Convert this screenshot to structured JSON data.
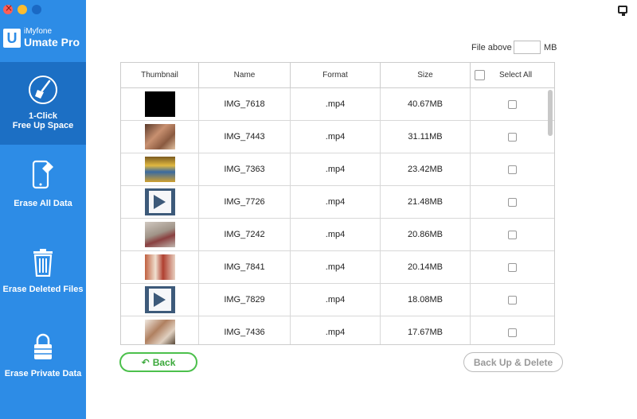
{
  "app": {
    "brand": "iMyfone",
    "product": "Umate Pro"
  },
  "sidebar": {
    "items": [
      {
        "label_line1": "1-Click",
        "label_line2": "Free Up Space",
        "icon": "broom-icon",
        "active": true
      },
      {
        "label": "Erase All Data",
        "icon": "phone-eraser-icon",
        "active": false
      },
      {
        "label": "Erase Deleted Files",
        "icon": "trash-icon",
        "active": false
      },
      {
        "label": "Erase Private Data",
        "icon": "lock-icon",
        "active": false
      }
    ]
  },
  "filter": {
    "label": "File above",
    "value": "",
    "unit": "MB"
  },
  "table": {
    "headers": {
      "thumbnail": "Thumbnail",
      "name": "Name",
      "format": "Format",
      "size": "Size",
      "select_all": "Select All"
    },
    "rows": [
      {
        "name": "IMG_7618",
        "format": ".mp4",
        "size": "40.67MB",
        "thumb": "black"
      },
      {
        "name": "IMG_7443",
        "format": ".mp4",
        "size": "31.11MB",
        "thumb": "photo1"
      },
      {
        "name": "IMG_7363",
        "format": ".mp4",
        "size": "23.42MB",
        "thumb": "photo2"
      },
      {
        "name": "IMG_7726",
        "format": ".mp4",
        "size": "21.48MB",
        "thumb": "video"
      },
      {
        "name": "IMG_7242",
        "format": ".mp4",
        "size": "20.86MB",
        "thumb": "photo3"
      },
      {
        "name": "IMG_7841",
        "format": ".mp4",
        "size": "20.14MB",
        "thumb": "photo4"
      },
      {
        "name": "IMG_7829",
        "format": ".mp4",
        "size": "18.08MB",
        "thumb": "video"
      },
      {
        "name": "IMG_7436",
        "format": ".mp4",
        "size": "17.67MB",
        "thumb": "photo5"
      }
    ]
  },
  "buttons": {
    "back": "Back",
    "backup_delete": "Back Up & Delete"
  },
  "colors": {
    "sidebar": "#2d8ce6",
    "sidebar_active": "#1c6fc4",
    "back_button": "#4cc04c"
  }
}
